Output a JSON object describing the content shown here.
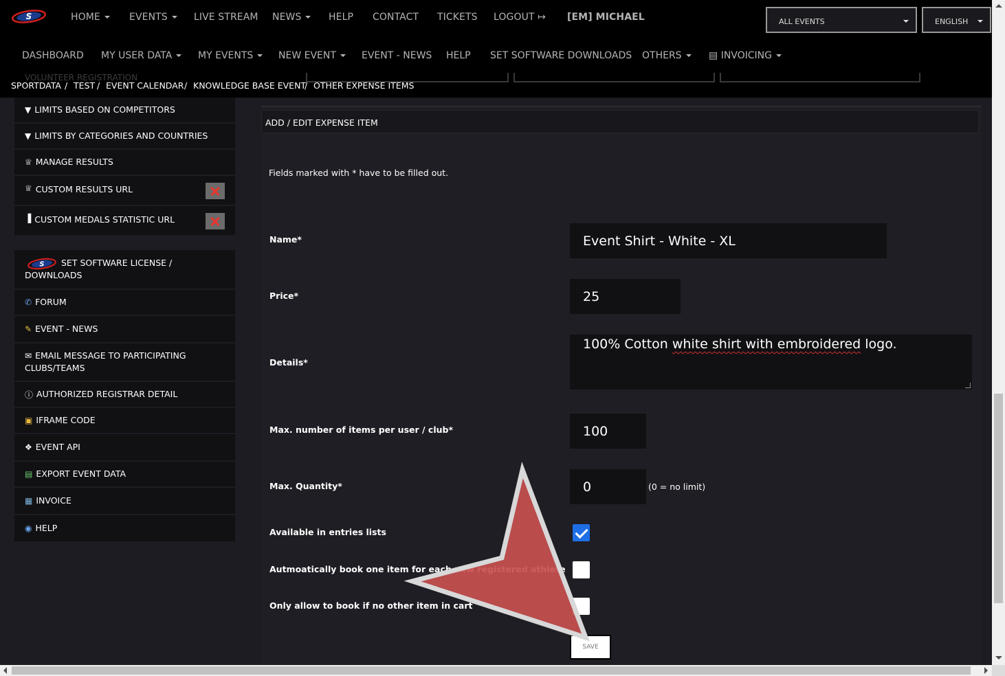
{
  "topnav": {
    "items": [
      {
        "label": "HOME",
        "dropdown": true
      },
      {
        "label": "EVENTS",
        "dropdown": true
      },
      {
        "label": "LIVE STREAM",
        "dropdown": false
      },
      {
        "label": "NEWS",
        "dropdown": true
      },
      {
        "label": "HELP",
        "dropdown": false
      },
      {
        "label": "CONTACT",
        "dropdown": false
      },
      {
        "label": "TICKETS",
        "dropdown": false
      },
      {
        "label": "LOGOUT",
        "dropdown": false
      }
    ],
    "user": "[EM] MICHAEL",
    "event_select": "ALL EVENTS",
    "language_select": "ENGLISH"
  },
  "subnav": {
    "items": [
      {
        "label": "DASHBOARD",
        "dropdown": false
      },
      {
        "label": "MY USER DATA",
        "dropdown": true
      },
      {
        "label": "MY EVENTS",
        "dropdown": true
      },
      {
        "label": "NEW EVENT",
        "dropdown": true
      },
      {
        "label": "EVENT - NEWS",
        "dropdown": false
      },
      {
        "label": "HELP",
        "dropdown": false
      },
      {
        "label": "SET SOFTWARE DOWNLOADS",
        "dropdown": false
      },
      {
        "label": "OTHERS",
        "dropdown": true
      },
      {
        "label": "INVOICING",
        "dropdown": true
      }
    ]
  },
  "breadcrumb": {
    "items": [
      "SPORTDATA",
      "TEST",
      "EVENT CALENDAR",
      "KNOWLEDGE BASE EVENT",
      "OTHER EXPENSE ITEMS"
    ],
    "separator": "/",
    "ghost_text": "VOLUNTEER REGISTRATION"
  },
  "sidebar": {
    "items": [
      {
        "label": "LIMITS BASED ON COMPETITORS",
        "icon": "filter-icon"
      },
      {
        "label": "LIMITS BY CATEGORIES AND COUNTRIES",
        "icon": "filter-icon"
      },
      {
        "label": "MANAGE RESULTS",
        "icon": "trophy-icon"
      },
      {
        "label": "CUSTOM RESULTS URL",
        "icon": "trophy-icon"
      },
      {
        "label": "CUSTOM MEDALS STATISTIC URL",
        "icon": "bar-chart-icon"
      },
      {
        "label": "SET SOFTWARE LICENSE / DOWNLOADS",
        "icon": "sportdata-logo"
      },
      {
        "label": "FORUM",
        "icon": "forum-icon"
      },
      {
        "label": "EVENT - NEWS",
        "icon": "news-icon"
      },
      {
        "label": "EMAIL MESSAGE TO PARTICIPATING CLUBS/TEAMS",
        "icon": "envelope-icon"
      },
      {
        "label": "AUTHORIZED REGISTRAR DETAIL",
        "icon": "info-icon"
      },
      {
        "label": "IFRAME CODE",
        "icon": "code-icon"
      },
      {
        "label": "EVENT API",
        "icon": "puzzle-icon"
      },
      {
        "label": "EXPORT EVENT DATA",
        "icon": "export-icon"
      },
      {
        "label": "INVOICE",
        "icon": "invoice-icon"
      },
      {
        "label": "HELP",
        "icon": "help-icon"
      }
    ]
  },
  "form": {
    "heading": "ADD / EDIT EXPENSE ITEM",
    "hint": "Fields marked with * have to be filled out.",
    "name_label": "Name*",
    "name_value": "Event Shirt - White - XL",
    "price_label": "Price*",
    "price_value": "25",
    "details_label": "Details*",
    "details_value_1": "100% Cotton ",
    "details_value_2": "white shirt with embroidered",
    "details_value_3": " logo.",
    "max_per_user_label": "Max. number of items per user / club*",
    "max_per_user_value": "100",
    "max_quantity_label": "Max. Quantity*",
    "max_quantity_value": "0",
    "max_quantity_note": "(0 = no limit)",
    "available_label": "Available in entries lists",
    "available_checked": true,
    "autobook_label": "Autmoatically book one item for each new registered athlete",
    "autobook_checked": false,
    "only_label": "Only allow to book if no other item in cart",
    "only_checked": false,
    "save_label": "SAVE"
  },
  "colors": {
    "background": "#1c1c22",
    "nav": "#000000",
    "checkbox_checked": "#1e6fe6",
    "delete": "#e8342c",
    "arrow_overlay": "#c85050"
  }
}
